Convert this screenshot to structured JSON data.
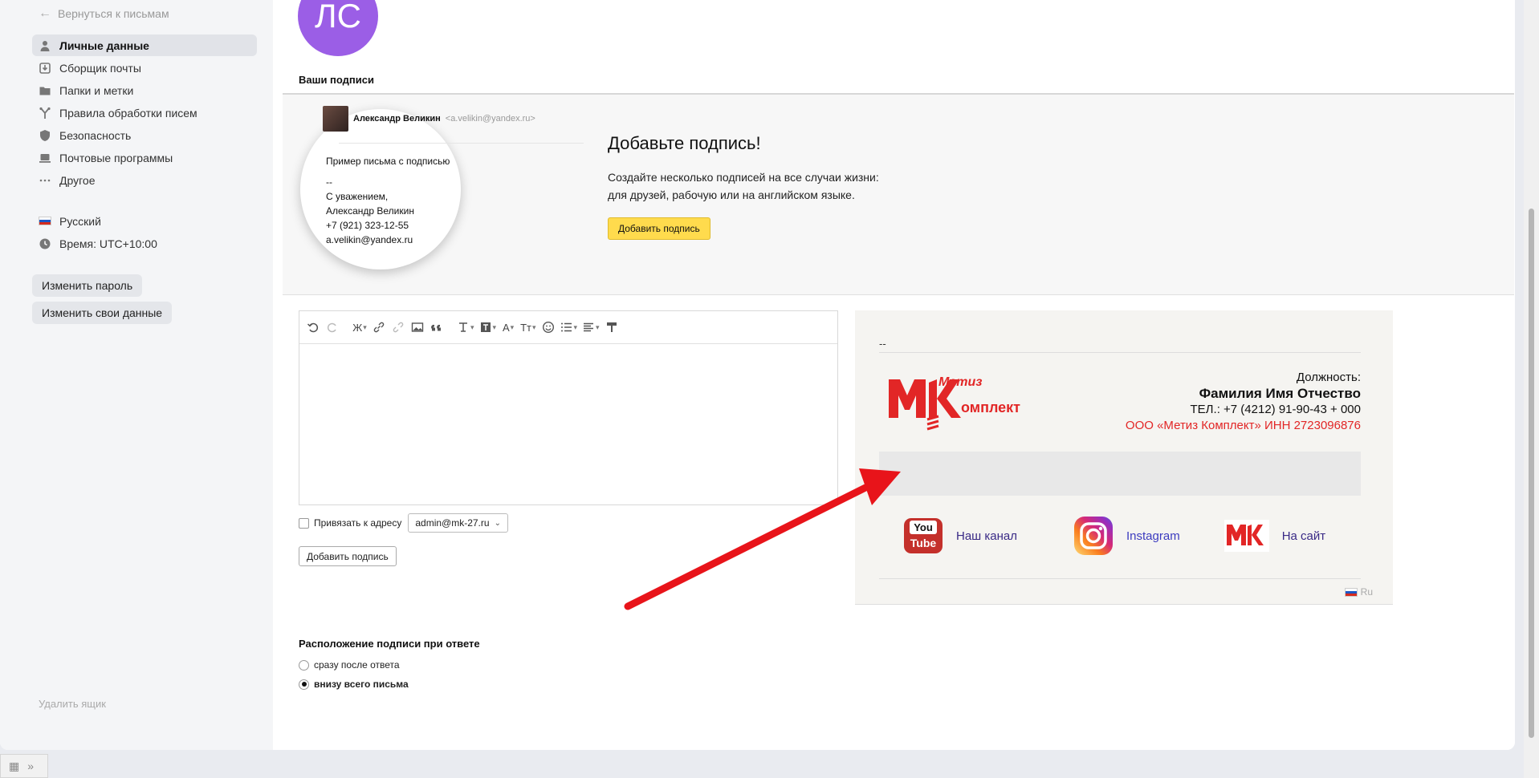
{
  "sidebar": {
    "back_label": "Вернуться к письмам",
    "items": [
      {
        "label": "Личные данные",
        "icon": "person-icon"
      },
      {
        "label": "Сборщик почты",
        "icon": "inbox-download-icon"
      },
      {
        "label": "Папки и метки",
        "icon": "folder-icon"
      },
      {
        "label": "Правила обработки писем",
        "icon": "filter-branch-icon"
      },
      {
        "label": "Безопасность",
        "icon": "shield-icon"
      },
      {
        "label": "Почтовые программы",
        "icon": "laptop-icon"
      },
      {
        "label": "Другое",
        "icon": "more-dots-icon"
      }
    ],
    "language": "Русский",
    "timezone": "Время: UTC+10:00",
    "change_password": "Изменить пароль",
    "change_data": "Изменить свои данные",
    "delete_box": "Удалить ящик"
  },
  "main": {
    "avatar_initials": "ЛС",
    "signatures_title": "Ваши подписи",
    "promo": {
      "sample_name": "Александр Великин",
      "sample_email": "<a.velikin@yandex.ru>",
      "sample_subject": "Пример письма с подписью",
      "sample_lines": [
        "--",
        "С уважением,",
        "Александр Великин",
        "+7 (921) 323-12-55",
        "a.velikin@yandex.ru"
      ],
      "title": "Добавьте подпись!",
      "text_line1": "Создайте несколько подписей на все случаи жизни:",
      "text_line2": "для друзей, рабочую или на английском языке.",
      "button": "Добавить подпись"
    },
    "toolbar": {
      "bold": "Ж",
      "font_color": "A",
      "font_size": "Тт"
    },
    "bind_label": "Привязать к адресу",
    "bind_address": "admin@mk-27.ru",
    "add_signature_button": "Добавить подпись",
    "placement": {
      "title": "Расположение подписи при ответе",
      "option1": "сразу после ответа",
      "option2": "внизу всего письма",
      "selected": 2
    }
  },
  "preview": {
    "dash": "--",
    "position_label": "Должность:",
    "full_name": "Фамилия Имя Отчество",
    "phone": "ТЕЛ.: +7 (4212) 91-90-43 + 000",
    "company": "ООО «Метиз Комплект» ИНН 2723096876",
    "logo_text_top": "Метиз",
    "logo_text_bottom": "омплект",
    "youtube_you": "You",
    "youtube_tube": "Tube",
    "link_youtube": "Наш канал",
    "link_instagram": "Instagram",
    "link_site": "На сайт",
    "lang": "Ru"
  },
  "colors": {
    "accent_yellow": "#ffdb4d",
    "avatar_purple": "#9b5ee6",
    "brand_red": "#e22626",
    "arrow_red": "#e8141a",
    "link_purple": "#3a2a86"
  }
}
